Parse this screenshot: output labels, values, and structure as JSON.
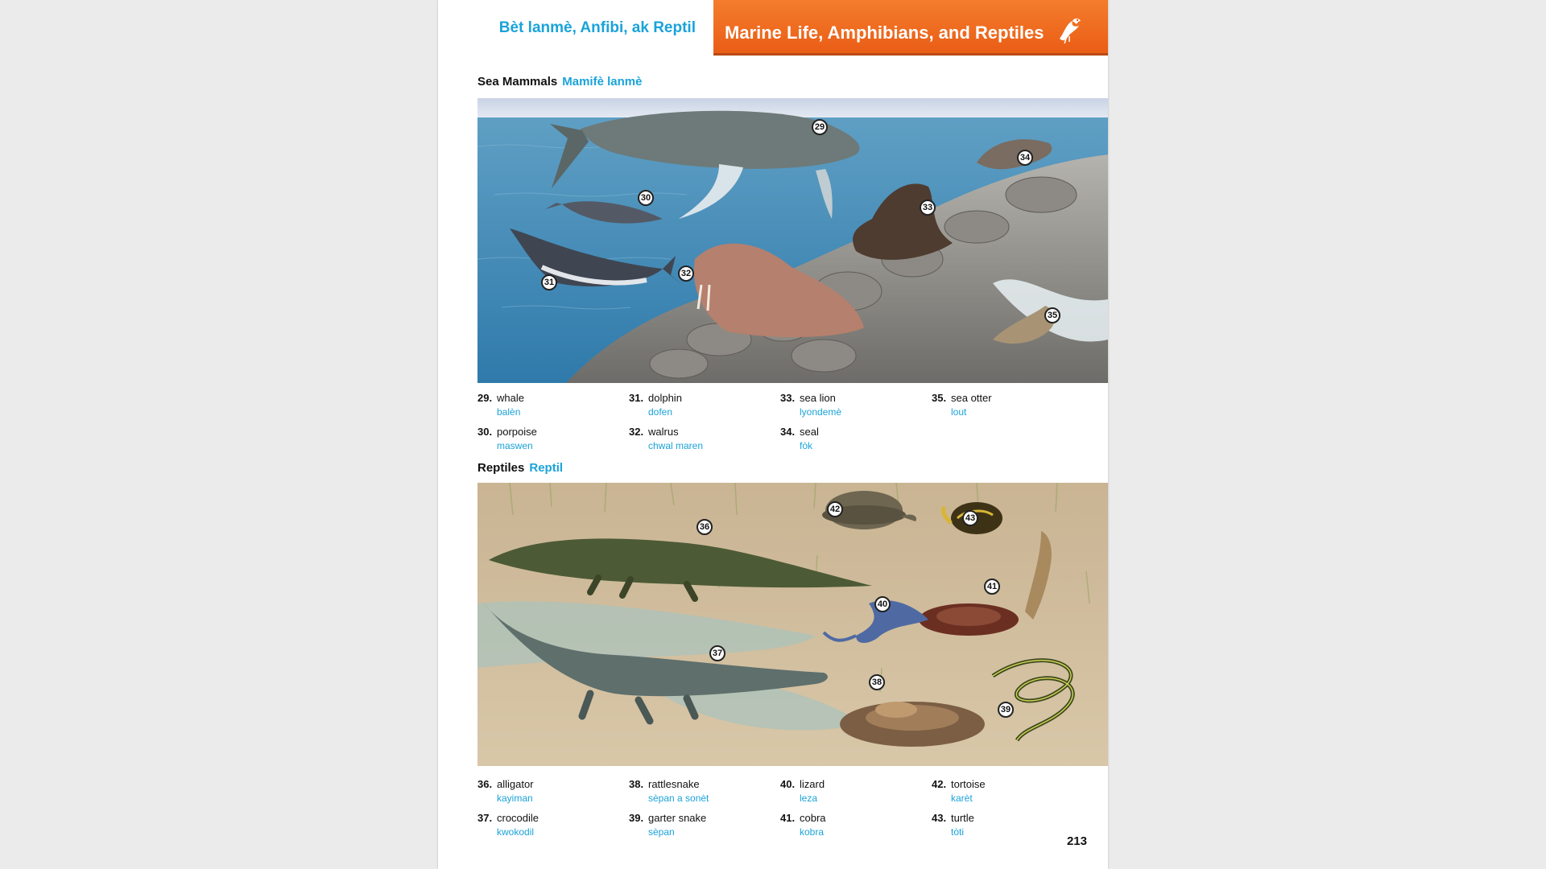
{
  "header": {
    "title_ht": "Bèt lanmè, Anfibi, ak Reptil",
    "title_en": "Marine Life, Amphibians, and Reptiles"
  },
  "sections": [
    {
      "title_en": "Sea Mammals",
      "title_ht": "Mamifè lanmè",
      "markers": [
        "29",
        "30",
        "31",
        "32",
        "33",
        "34",
        "35"
      ],
      "vocab": [
        {
          "num": "29.",
          "en": "whale",
          "ht": "balèn"
        },
        {
          "num": "31.",
          "en": "dolphin",
          "ht": "dofen"
        },
        {
          "num": "33.",
          "en": "sea lion",
          "ht": "lyondemè"
        },
        {
          "num": "35.",
          "en": "sea otter",
          "ht": "lout"
        },
        {
          "num": "30.",
          "en": "porpoise",
          "ht": "maswen"
        },
        {
          "num": "32.",
          "en": "walrus",
          "ht": "chwal maren"
        },
        {
          "num": "34.",
          "en": "seal",
          "ht": "fòk"
        }
      ]
    },
    {
      "title_en": "Reptiles",
      "title_ht": "Reptil",
      "markers": [
        "36",
        "37",
        "38",
        "39",
        "40",
        "41",
        "42",
        "43"
      ],
      "vocab": [
        {
          "num": "36.",
          "en": "alligator",
          "ht": "kayiman"
        },
        {
          "num": "38.",
          "en": "rattlesnake",
          "ht": "sèpan a sonèt"
        },
        {
          "num": "40.",
          "en": "lizard",
          "ht": "leza"
        },
        {
          "num": "42.",
          "en": "tortoise",
          "ht": "karèt"
        },
        {
          "num": "37.",
          "en": "crocodile",
          "ht": "kwokodil"
        },
        {
          "num": "39.",
          "en": "garter snake",
          "ht": "sèpan"
        },
        {
          "num": "41.",
          "en": "cobra",
          "ht": "kobra"
        },
        {
          "num": "43.",
          "en": "turtle",
          "ht": "tòti"
        }
      ]
    }
  ],
  "page_number": "213",
  "icons": {
    "header": "bird-icon"
  },
  "colors": {
    "accent": "#1aa3d9",
    "banner": "#ee6a1f"
  }
}
